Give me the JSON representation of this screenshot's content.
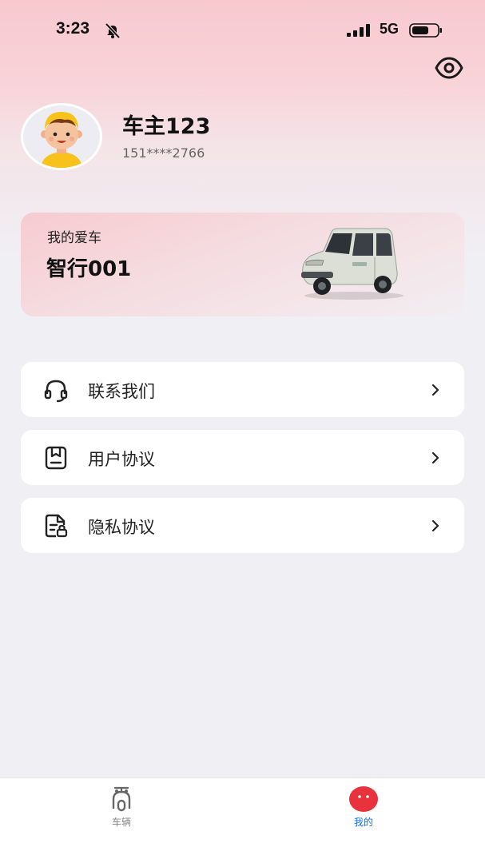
{
  "status_bar": {
    "time": "3:23",
    "network": "5G",
    "icons": [
      "bell-off-icon",
      "signal-icon",
      "battery-icon"
    ]
  },
  "header": {
    "eye_icon": "eye-icon"
  },
  "profile": {
    "name": "车主123",
    "phone": "151****2766"
  },
  "my_car": {
    "label": "我的爱车",
    "name": "智行001"
  },
  "menu": [
    {
      "label": "联系我们",
      "icon": "headset-icon"
    },
    {
      "label": "用户协议",
      "icon": "document-icon"
    },
    {
      "label": "隐私协议",
      "icon": "privacy-document-icon"
    }
  ],
  "tabbar": {
    "tabs": [
      {
        "label": "车辆",
        "icon": "scooter-icon",
        "active": false
      },
      {
        "label": "我的",
        "icon": "profile-face-icon",
        "active": true
      }
    ]
  },
  "colors": {
    "accent": "#e8323c",
    "active_tab_text": "#1a6fd8",
    "inactive_tab_text": "#888888",
    "header_gradient": "#f7c9cf",
    "page_bg": "#f0eff4"
  }
}
